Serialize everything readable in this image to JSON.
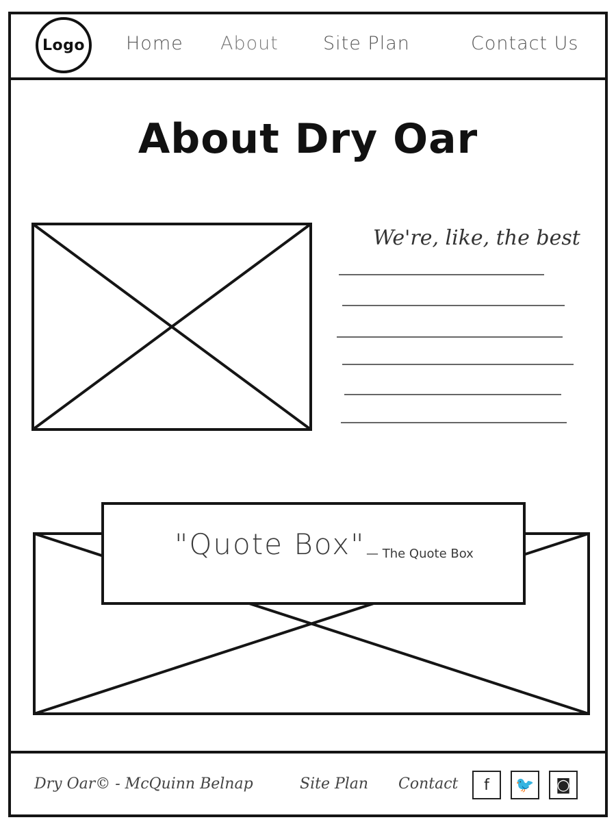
{
  "header": {
    "logo_label": "Logo",
    "nav": [
      {
        "label": "Home"
      },
      {
        "label": "About"
      },
      {
        "label": "Site Plan"
      },
      {
        "label": "Contact Us"
      }
    ]
  },
  "main": {
    "title": "About Dry Oar",
    "tagline": "We're, like, the best",
    "quote": {
      "text": "\"Quote Box\"",
      "attribution": "— The Quote Box"
    }
  },
  "footer": {
    "copyright": "Dry Oar© - McQuinn Belnap",
    "site_plan": "Site Plan",
    "contact": "Contact",
    "social": [
      {
        "icon": "facebook-icon",
        "glyph": "f"
      },
      {
        "icon": "twitter-icon",
        "glyph": "🐦"
      },
      {
        "icon": "instagram-icon",
        "glyph": "◙"
      }
    ]
  }
}
